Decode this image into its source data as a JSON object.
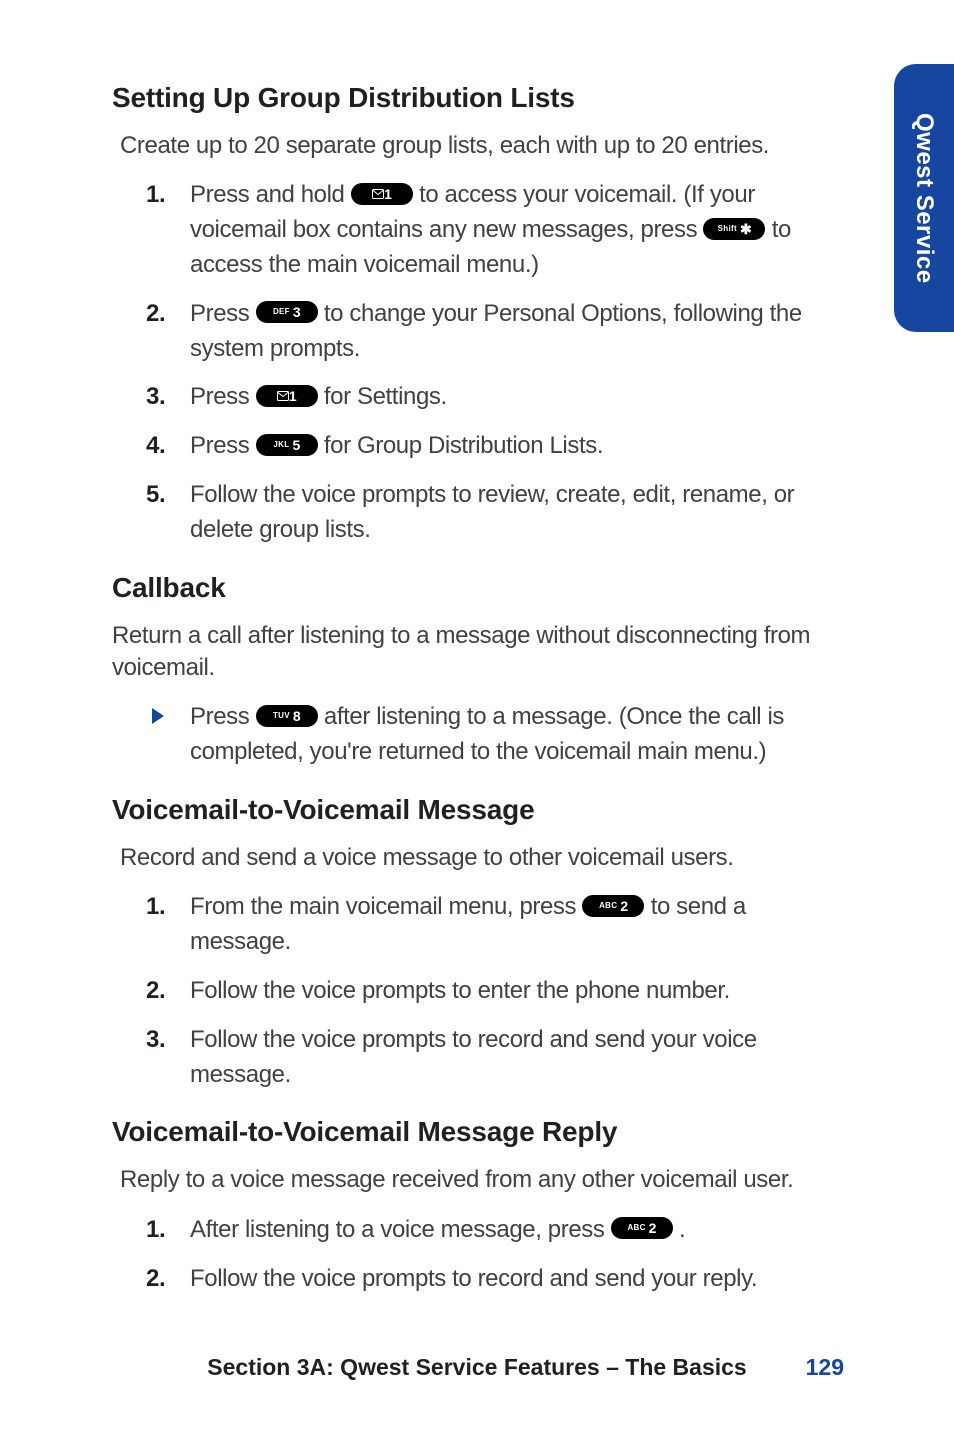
{
  "side_tab": "Qwest Service",
  "sections": {
    "group_dist": {
      "heading": "Setting Up Group Distribution Lists",
      "intro": "Create up to 20 separate group lists, each with up to 20 entries.",
      "steps": {
        "s1a": "Press and hold ",
        "s1b": " to access your voicemail. (If your voicemail box contains any new messages, press ",
        "s1c": " to access the main voicemail menu.)",
        "s2a": "Press ",
        "s2b": " to change your Personal Options, following the system prompts.",
        "s3a": "Press ",
        "s3b": " for Settings.",
        "s4a": "Press ",
        "s4b": " for Group Distribution Lists.",
        "s5": "Follow the voice prompts to review, create, edit, rename, or delete group lists."
      }
    },
    "callback": {
      "heading": "Callback",
      "intro": "Return a call after listening to a message without disconnecting from voicemail.",
      "bullet_a": "Press ",
      "bullet_b": " after listening to a message. (Once the call is completed, you're returned to the voicemail main menu.)"
    },
    "v2v": {
      "heading": "Voicemail-to-Voicemail Message",
      "intro": "Record and send a voice message to other voicemail users.",
      "steps": {
        "s1a": "From the main voicemail menu, press ",
        "s1b": " to send a message.",
        "s2": "Follow the voice prompts to enter the phone number.",
        "s3": "Follow the voice prompts to record and send your voice message."
      }
    },
    "v2v_reply": {
      "heading": "Voicemail-to-Voicemail Message Reply",
      "intro": "Reply to a voice message received from any other voicemail user.",
      "steps": {
        "s1a": "After listening to a voice message, press ",
        "s1b": ".",
        "s2": "Follow the voice prompts to record and send your reply."
      }
    }
  },
  "keys": {
    "mail1_sub": "✉",
    "mail1_main": "1",
    "shiftstar_sub": "Shift",
    "shiftstar_main": "✱",
    "def3_sub": "DEF",
    "def3_main": "3",
    "jkl5_sub": "JKL",
    "jkl5_main": "5",
    "tuv8_sub": "TUV",
    "tuv8_main": "8",
    "abc2_sub": "ABC",
    "abc2_main": "2"
  },
  "nums": {
    "n1": "1.",
    "n2": "2.",
    "n3": "3.",
    "n4": "4.",
    "n5": "5."
  },
  "footer": {
    "text": "Section 3A: Qwest Service Features – The Basics",
    "page": "129"
  }
}
